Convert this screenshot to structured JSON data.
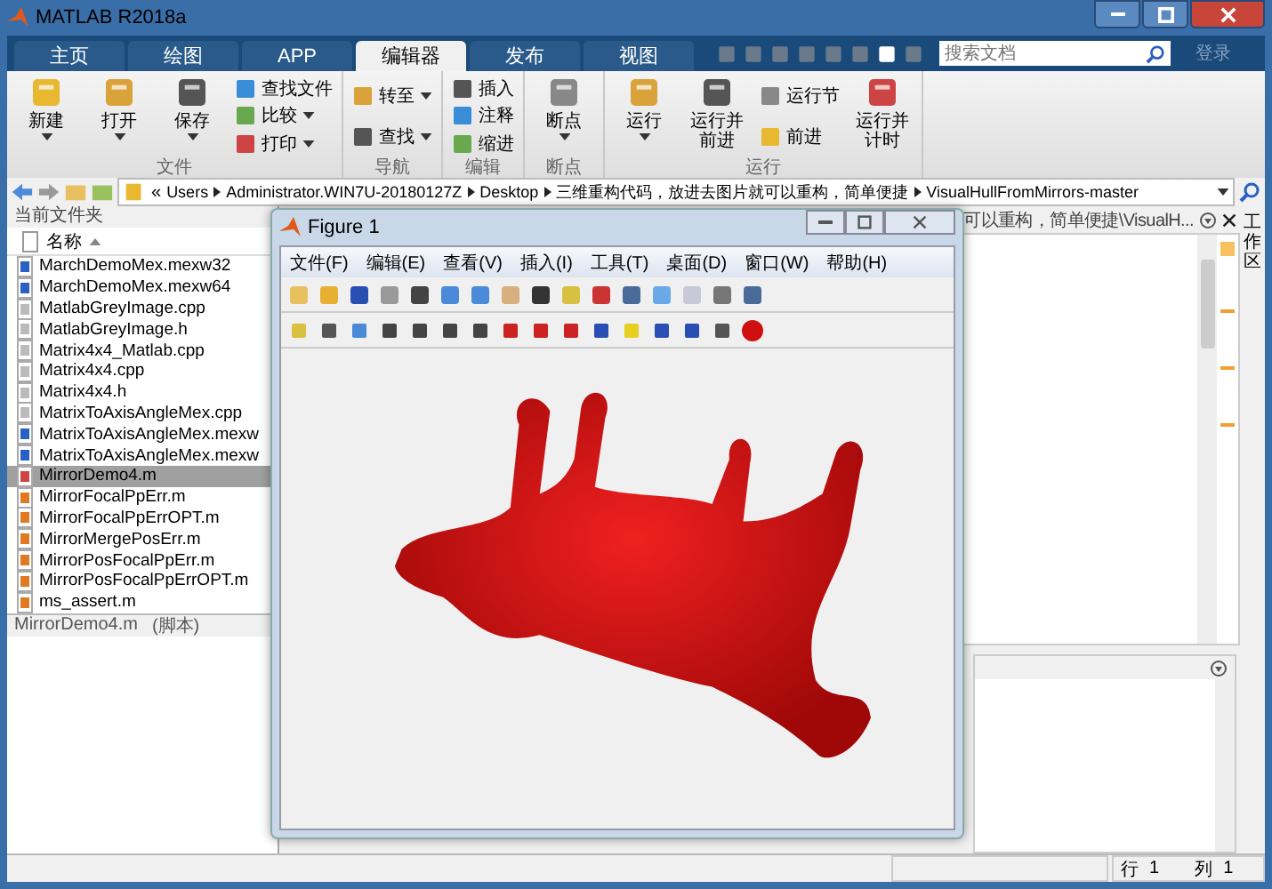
{
  "window": {
    "title": "MATLAB R2018a"
  },
  "tabs": [
    {
      "label": "主页",
      "selected": false
    },
    {
      "label": "绘图",
      "selected": false
    },
    {
      "label": "APP",
      "selected": false
    },
    {
      "label": "编辑器",
      "selected": true
    },
    {
      "label": "发布",
      "selected": false
    },
    {
      "label": "视图",
      "selected": false
    }
  ],
  "search": {
    "placeholder": "搜索文档"
  },
  "login": "登录",
  "ribbon": [
    {
      "label": "文件",
      "buttons": [
        {
          "label": "新建",
          "kind": "large",
          "menu": true
        },
        {
          "label": "打开",
          "kind": "large",
          "menu": true
        },
        {
          "label": "保存",
          "kind": "large",
          "menu": true
        },
        {
          "label": "查找文件",
          "kind": "small",
          "menu": false
        },
        {
          "label": "比较",
          "kind": "small",
          "menu": true
        },
        {
          "label": "打印",
          "kind": "small",
          "menu": true
        }
      ]
    },
    {
      "label": "导航",
      "buttons": [
        {
          "label": "转至",
          "kind": "small",
          "menu": true
        },
        {
          "label": "查找",
          "kind": "small",
          "menu": true
        }
      ]
    },
    {
      "label": "编辑",
      "buttons": [
        {
          "label": "插入",
          "kind": "small",
          "menu": false
        },
        {
          "label": "注释",
          "kind": "small",
          "menu": false
        },
        {
          "label": "缩进",
          "kind": "small",
          "menu": false
        }
      ]
    },
    {
      "label": "断点",
      "buttons": [
        {
          "label": "断点",
          "kind": "large",
          "menu": true
        }
      ]
    },
    {
      "label": "运行",
      "buttons": [
        {
          "label": "运行",
          "kind": "large",
          "menu": true
        },
        {
          "label": "运行并前进",
          "kind": "large",
          "menu": false
        },
        {
          "label": "运行节",
          "kind": "small",
          "menu": false
        },
        {
          "label": "前进",
          "kind": "small",
          "menu": false
        },
        {
          "label": "运行并计时",
          "kind": "large",
          "menu": false
        }
      ]
    }
  ],
  "address": {
    "lead": "«",
    "segments": [
      "Users",
      "Administrator.WIN7U-20180127Z",
      "Desktop",
      "三维重构代码，放进去图片就可以重构，简单便捷",
      "VisualHullFromMirrors-master"
    ]
  },
  "folder_panel": {
    "title": "当前文件夹",
    "column": "名称",
    "files": [
      {
        "name": "MarchDemoMex.mexw32",
        "kind": "mex",
        "selected": false
      },
      {
        "name": "MarchDemoMex.mexw64",
        "kind": "mex",
        "selected": false
      },
      {
        "name": "MatlabGreyImage.cpp",
        "kind": "doc",
        "selected": false
      },
      {
        "name": "MatlabGreyImage.h",
        "kind": "doc",
        "selected": false
      },
      {
        "name": "Matrix4x4_Matlab.cpp",
        "kind": "doc",
        "selected": false
      },
      {
        "name": "Matrix4x4.cpp",
        "kind": "doc",
        "selected": false
      },
      {
        "name": "Matrix4x4.h",
        "kind": "doc",
        "selected": false
      },
      {
        "name": "MatrixToAxisAngleMex.cpp",
        "kind": "doc",
        "selected": false
      },
      {
        "name": "MatrixToAxisAngleMex.mexw",
        "kind": "mex",
        "selected": false
      },
      {
        "name": "MatrixToAxisAngleMex.mexw",
        "kind": "mex",
        "selected": false
      },
      {
        "name": "MirrorDemo4.m",
        "kind": "script",
        "selected": true
      },
      {
        "name": "MirrorFocalPpErr.m",
        "kind": "func",
        "selected": false
      },
      {
        "name": "MirrorFocalPpErrOPT.m",
        "kind": "func",
        "selected": false
      },
      {
        "name": "MirrorMergePosErr.m",
        "kind": "func",
        "selected": false
      },
      {
        "name": "MirrorPosFocalPpErr.m",
        "kind": "func",
        "selected": false
      },
      {
        "name": "MirrorPosFocalPpErrOPT.m",
        "kind": "func",
        "selected": false
      },
      {
        "name": "ms_assert.m",
        "kind": "func",
        "selected": false
      }
    ],
    "detail_name": "MirrorDemo4.m",
    "detail_type": "(脚本)"
  },
  "editor": {
    "title": "可以重构，简单便捷\\VisualH..."
  },
  "workspace_tab": "工作区",
  "status": {
    "line_label": "行",
    "line": "1",
    "col_label": "列",
    "col": "1"
  },
  "figure": {
    "title": "Figure 1",
    "menu": [
      "文件(F)",
      "编辑(E)",
      "查看(V)",
      "插入(I)",
      "工具(T)",
      "桌面(D)",
      "窗口(W)",
      "帮助(H)"
    ]
  }
}
